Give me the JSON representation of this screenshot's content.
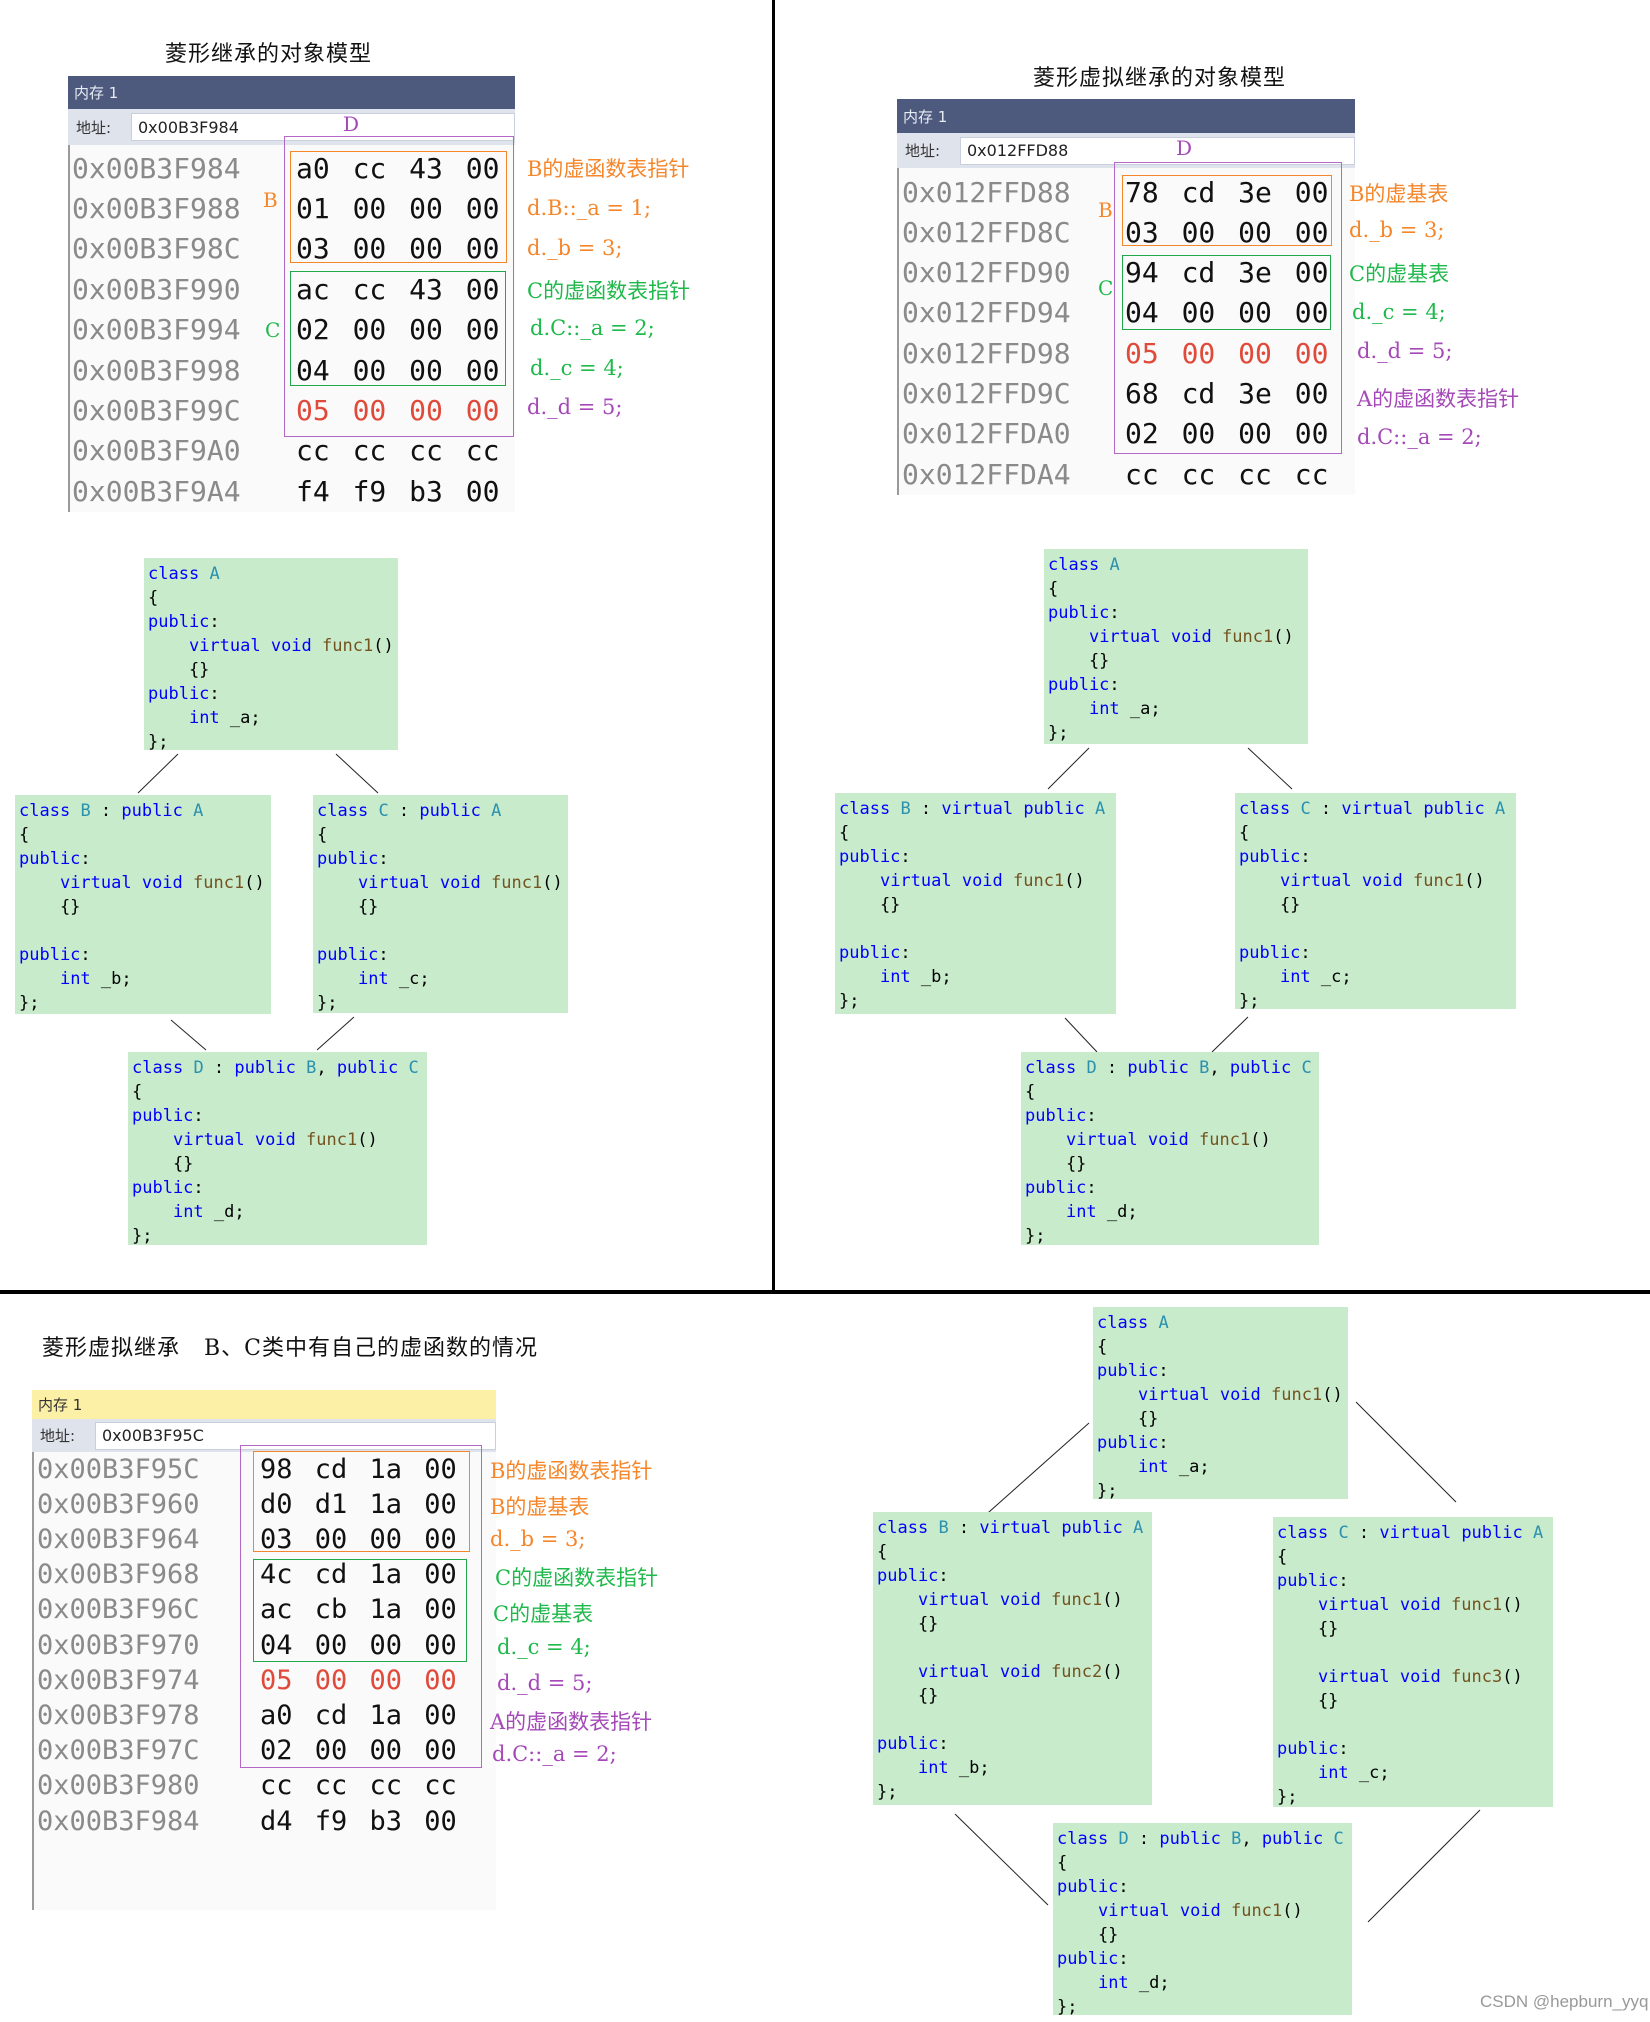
{
  "panels": {
    "top_left": {
      "title": "菱形继承的对象模型",
      "memory": {
        "window_title": "内存 1",
        "address_label": "地址:",
        "address_value": "0x00B3F984",
        "rows": [
          {
            "addr": "0x00B3F984",
            "bytes": "a0 cc 43 00"
          },
          {
            "addr": "0x00B3F988",
            "bytes": "01 00 00 00"
          },
          {
            "addr": "0x00B3F98C",
            "bytes": "03 00 00 00"
          },
          {
            "addr": "0x00B3F990",
            "bytes": "ac cc 43 00"
          },
          {
            "addr": "0x00B3F994",
            "bytes": "02 00 00 00"
          },
          {
            "addr": "0x00B3F998",
            "bytes": "04 00 00 00"
          },
          {
            "addr": "0x00B3F99C",
            "bytes": "05 00 00 00"
          },
          {
            "addr": "0x00B3F9A0",
            "bytes": "cc cc cc cc"
          },
          {
            "addr": "0x00B3F9A4",
            "bytes": "f4 f9 b3 00"
          }
        ],
        "region_labels": {
          "d": "D",
          "b": "B",
          "c": "C"
        },
        "annotations": [
          "B的虚函数表指针",
          "d.B::_a = 1;",
          "d._b = 3;",
          "C的虚函数表指针",
          "d.C::_a = 2;",
          "d._c = 4;",
          "d._d = 5;"
        ]
      },
      "classes": {
        "a": {
          "name": "A",
          "header": "",
          "lines": [
            "{",
            "public:",
            "    virtual void func1()",
            "    {}",
            "public:",
            "    int _a;",
            "};"
          ]
        },
        "b": {
          "name": "B",
          "bases": "public A",
          "lines": [
            "{",
            "public:",
            "    virtual void func1()",
            "    {}",
            "",
            "public:",
            "    int _b;",
            "};"
          ]
        },
        "c": {
          "name": "C",
          "bases": "public A",
          "lines": [
            "{",
            "public:",
            "    virtual void func1()",
            "    {}",
            "",
            "public:",
            "    int _c;",
            "};"
          ]
        },
        "d": {
          "name": "D",
          "bases": "public B, public C",
          "lines": [
            "{",
            "public:",
            "    virtual void func1()",
            "    {}",
            "public:",
            "    int _d;",
            "};"
          ]
        }
      }
    },
    "top_right": {
      "title": "菱形虚拟继承的对象模型",
      "memory": {
        "window_title": "内存 1",
        "address_label": "地址:",
        "address_value": "0x012FFD88",
        "rows": [
          {
            "addr": "0x012FFD88",
            "bytes": "78 cd 3e 00"
          },
          {
            "addr": "0x012FFD8C",
            "bytes": "03 00 00 00"
          },
          {
            "addr": "0x012FFD90",
            "bytes": "94 cd 3e 00"
          },
          {
            "addr": "0x012FFD94",
            "bytes": "04 00 00 00"
          },
          {
            "addr": "0x012FFD98",
            "bytes": "05 00 00 00"
          },
          {
            "addr": "0x012FFD9C",
            "bytes": "68 cd 3e 00"
          },
          {
            "addr": "0x012FFDA0",
            "bytes": "02 00 00 00"
          },
          {
            "addr": "0x012FFDA4",
            "bytes": "cc cc cc cc"
          }
        ],
        "region_labels": {
          "d": "D",
          "b": "B",
          "c": "C"
        },
        "annotations": [
          "B的虚基表",
          "d._b = 3;",
          "C的虚基表",
          "d._c = 4;",
          "d._d = 5;",
          "A的虚函数表指针",
          "d.C::_a = 2;"
        ]
      },
      "classes": {
        "a": {
          "name": "A",
          "lines": [
            "{",
            "public:",
            "    virtual void func1()",
            "    {}",
            "public:",
            "    int _a;",
            "};"
          ]
        },
        "b": {
          "name": "B",
          "bases": "virtual public A",
          "lines": [
            "{",
            "public:",
            "    virtual void func1()",
            "    {}",
            "",
            "public:",
            "    int _b;",
            "};"
          ]
        },
        "c": {
          "name": "C",
          "bases": "virtual public A",
          "lines": [
            "{",
            "public:",
            "    virtual void func1()",
            "    {}",
            "",
            "public:",
            "    int _c;",
            "};"
          ]
        },
        "d": {
          "name": "D",
          "bases": "public B, public C",
          "lines": [
            "{",
            "public:",
            "    virtual void func1()",
            "    {}",
            "public:",
            "    int _d;",
            "};"
          ]
        }
      }
    },
    "bottom_left": {
      "title": "菱形虚拟继承   B、C类中有自己的虚函数的情况",
      "memory": {
        "window_title": "内存 1",
        "address_label": "地址:",
        "address_value": "0x00B3F95C",
        "rows": [
          {
            "addr": "0x00B3F95C",
            "bytes": "98 cd 1a 00"
          },
          {
            "addr": "0x00B3F960",
            "bytes": "d0 d1 1a 00"
          },
          {
            "addr": "0x00B3F964",
            "bytes": "03 00 00 00"
          },
          {
            "addr": "0x00B3F968",
            "bytes": "4c cd 1a 00"
          },
          {
            "addr": "0x00B3F96C",
            "bytes": "ac cb 1a 00"
          },
          {
            "addr": "0x00B3F970",
            "bytes": "04 00 00 00"
          },
          {
            "addr": "0x00B3F974",
            "bytes": "05 00 00 00"
          },
          {
            "addr": "0x00B3F978",
            "bytes": "a0 cd 1a 00"
          },
          {
            "addr": "0x00B3F97C",
            "bytes": "02 00 00 00"
          },
          {
            "addr": "0x00B3F980",
            "bytes": "cc cc cc cc"
          },
          {
            "addr": "0x00B3F984",
            "bytes": "d4 f9 b3 00"
          }
        ],
        "annotations": [
          "B的虚函数表指针",
          "B的虚基表",
          "d._b = 3;",
          "C的虚函数表指针",
          "C的虚基表",
          "d._c = 4;",
          "d._d = 5;",
          "A的虚函数表指针",
          "d.C::_a = 2;"
        ]
      }
    },
    "bottom_right": {
      "classes": {
        "a": {
          "name": "A",
          "lines": [
            "{",
            "public:",
            "    virtual void func1()",
            "    {}",
            "public:",
            "    int _a;",
            "};"
          ]
        },
        "b": {
          "name": "B",
          "bases": "virtual public A",
          "lines": [
            "{",
            "public:",
            "    virtual void func1()",
            "    {}",
            "",
            "    virtual void func2()",
            "    {}",
            "",
            "public:",
            "    int _b;",
            "};"
          ]
        },
        "c": {
          "name": "C",
          "bases": "virtual public A",
          "lines": [
            "{",
            "public:",
            "    virtual void func1()",
            "    {}",
            "",
            "    virtual void func3()",
            "    {}",
            "",
            "public:",
            "    int _c;",
            "};"
          ]
        },
        "d": {
          "name": "D",
          "bases": "public B, public C",
          "lines": [
            "{",
            "public:",
            "    virtual void func1()",
            "    {}",
            "public:",
            "    int _d;",
            "};"
          ]
        }
      }
    }
  },
  "watermark": "CSDN @hepburn_yyq",
  "colors": {
    "keyword": "#0000ff",
    "class_name": "#2b91af",
    "function": "#74531f",
    "code_bg": "#c8ebcc",
    "orange": "#f5862a",
    "green": "#1fb84b",
    "purple": "#a548b8",
    "red_bytes": "#e04a3a",
    "mem_header_dark": "#4d5a7d",
    "mem_header_yellow": "#fcefa6"
  }
}
